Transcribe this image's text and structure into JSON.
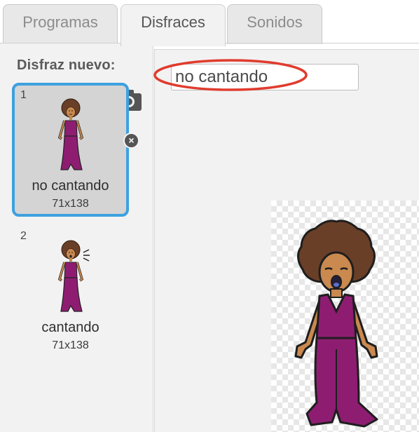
{
  "tabs": [
    {
      "label": "Programas",
      "active": false
    },
    {
      "label": "Disfraces",
      "active": true
    },
    {
      "label": "Sonidos",
      "active": false
    }
  ],
  "new_costume": {
    "heading": "Disfraz nuevo:",
    "icons": [
      "sprite-library-icon",
      "paint-brush-icon",
      "upload-icon",
      "camera-icon"
    ]
  },
  "costumes": [
    {
      "number": "1",
      "name": "no cantando",
      "size": "71x138",
      "selected": true
    },
    {
      "number": "2",
      "name": "cantando",
      "size": "71x138",
      "selected": false
    }
  ],
  "editor": {
    "costume_name_value": "no cantando"
  },
  "colors": {
    "selection_border": "#3ea1df",
    "highlight_ellipse": "#e03c2e",
    "dress": "#8e1d72",
    "skin": "#c9894f",
    "hair": "#6a3f28"
  }
}
